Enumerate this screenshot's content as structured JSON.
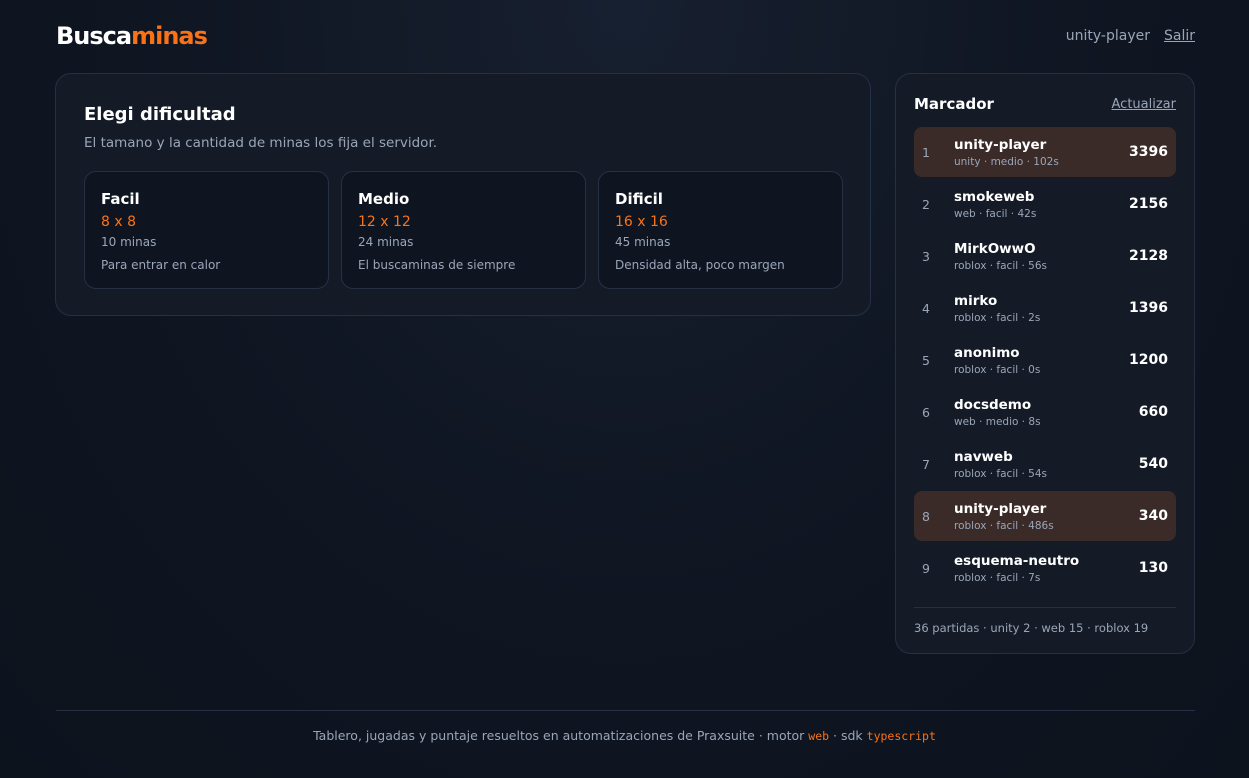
{
  "header": {
    "logo_part1": "Busca",
    "logo_part2": "minas",
    "user": "unity-player",
    "logout_label": "Salir"
  },
  "difficulty": {
    "title": "Elegi dificultad",
    "subtitle": "El tamano y la cantidad de minas los fija el servidor.",
    "options": [
      {
        "name": "Facil",
        "size": "8 x 8",
        "mines": "10 minas",
        "desc": "Para entrar en calor"
      },
      {
        "name": "Medio",
        "size": "12 x 12",
        "mines": "24 minas",
        "desc": "El buscaminas de siempre"
      },
      {
        "name": "Dificil",
        "size": "16 x 16",
        "mines": "45 minas",
        "desc": "Densidad alta, poco margen"
      }
    ]
  },
  "scoreboard": {
    "title": "Marcador",
    "refresh_label": "Actualizar",
    "rows": [
      {
        "rank": "1",
        "player": "unity-player",
        "meta": "unity · medio · 102s",
        "score": "3396",
        "highlight": true
      },
      {
        "rank": "2",
        "player": "smokeweb",
        "meta": "web · facil · 42s",
        "score": "2156",
        "highlight": false
      },
      {
        "rank": "3",
        "player": "MirkOwwO",
        "meta": "roblox · facil · 56s",
        "score": "2128",
        "highlight": false
      },
      {
        "rank": "4",
        "player": "mirko",
        "meta": "roblox · facil · 2s",
        "score": "1396",
        "highlight": false
      },
      {
        "rank": "5",
        "player": "anonimo",
        "meta": "roblox · facil · 0s",
        "score": "1200",
        "highlight": false
      },
      {
        "rank": "6",
        "player": "docsdemo",
        "meta": "web · medio · 8s",
        "score": "660",
        "highlight": false
      },
      {
        "rank": "7",
        "player": "navweb",
        "meta": "roblox · facil · 54s",
        "score": "540",
        "highlight": false
      },
      {
        "rank": "8",
        "player": "unity-player",
        "meta": "roblox · facil · 486s",
        "score": "340",
        "highlight": true
      },
      {
        "rank": "9",
        "player": "esquema-neutro",
        "meta": "roblox · facil · 7s",
        "score": "130",
        "highlight": false
      }
    ],
    "summary": "36 partidas · unity 2 · web 15 · roblox 19"
  },
  "footer": {
    "text": "Tablero, jugadas y puntaje resueltos en automatizaciones de Praxsuite · motor ",
    "engine": "web",
    "sdk_label": " · sdk ",
    "sdk": "typescript"
  }
}
